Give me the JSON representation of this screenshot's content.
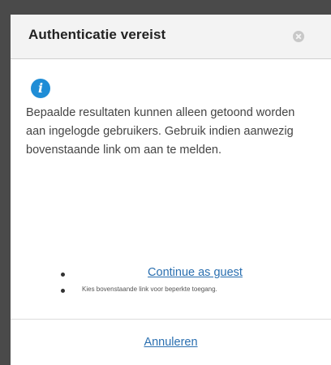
{
  "dialog": {
    "title": "Authenticatie vereist",
    "close_icon": "close-icon",
    "info_icon": "info-icon",
    "info_glyph": "i",
    "message": "Bepaalde resultaten kunnen alleen getoond worden aan ingelogde gebruikers. Gebruik indien aanwezig bovenstaande link om aan te melden.",
    "options": {
      "guest_link": "Continue as guest",
      "hint": "Kies bovenstaande link voor beperkte toegang."
    },
    "cancel_label": "Annuleren"
  },
  "colors": {
    "header_bg": "#f3f3f3",
    "link": "#2a6fb0",
    "info_icon": "#1f8dd6",
    "backdrop": "#4a4a4a"
  }
}
